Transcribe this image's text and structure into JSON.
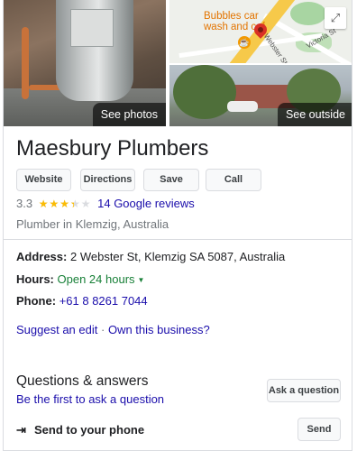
{
  "media": {
    "see_photos_label": "See photos",
    "see_outside_label": "See outside",
    "map_business_name": "Bubbles car wash and caf",
    "map_street_1": "Webster St",
    "map_street_2": "Victoria St",
    "expand_icon": "expand-icon"
  },
  "business": {
    "name": "Maesbury Plumbers",
    "rating": "3.3",
    "rating_value": 3.3,
    "reviews_label": "14 Google reviews",
    "category": "Plumber in Klemzig, Australia"
  },
  "actions": {
    "website": "Website",
    "directions": "Directions",
    "save": "Save",
    "call": "Call"
  },
  "details": {
    "address_label": "Address:",
    "address_value": "2 Webster St, Klemzig SA 5087, Australia",
    "hours_label": "Hours:",
    "hours_value": "Open 24 hours",
    "phone_label": "Phone:",
    "phone_value": "+61 8 8261 7044"
  },
  "edit_links": {
    "suggest_edit": "Suggest an edit",
    "separator": "·",
    "own_business": "Own this business?"
  },
  "qa": {
    "title": "Questions & answers",
    "first_to_ask": "Be the first to ask a question",
    "ask_button": "Ask a question"
  },
  "send": {
    "label": "Send to your phone",
    "button": "Send"
  },
  "colors": {
    "link": "#1a0dab",
    "open_green": "#188038",
    "star": "#fbbc04",
    "pin": "#d93025"
  }
}
